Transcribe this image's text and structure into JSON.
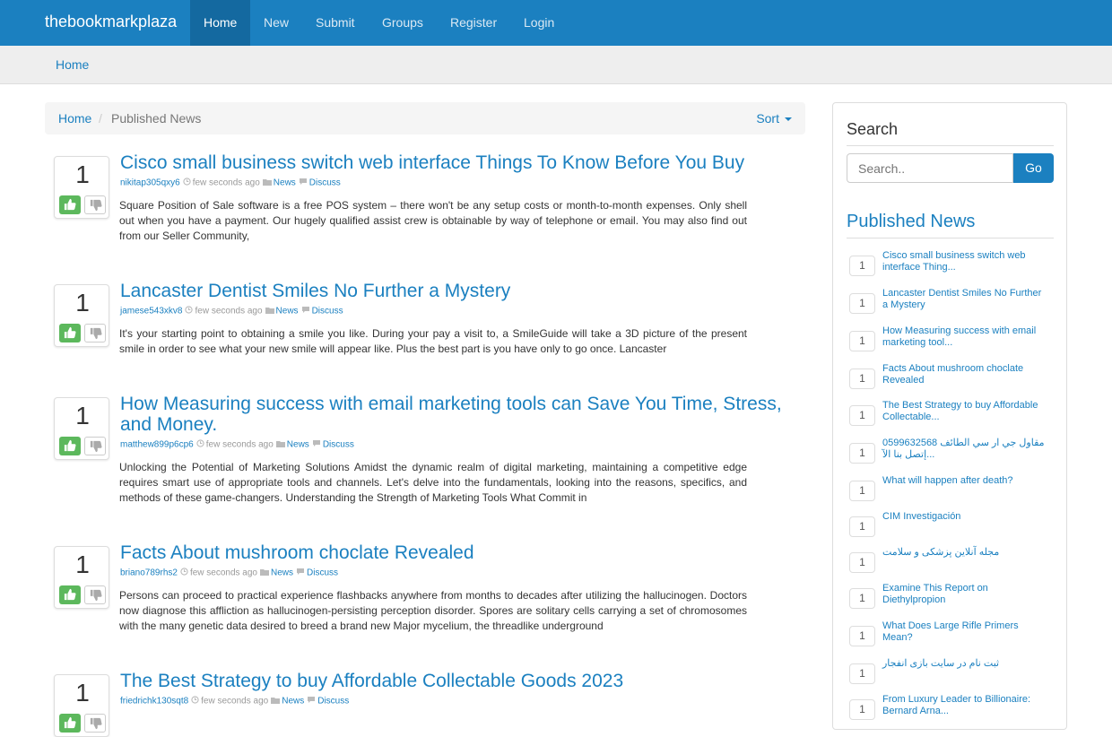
{
  "navbar": {
    "brand": "thebookmarkplaza",
    "items": [
      "Home",
      "New",
      "Submit",
      "Groups",
      "Register",
      "Login"
    ]
  },
  "subband": {
    "home": "Home"
  },
  "breadcrumb": {
    "home": "Home",
    "separator": "/",
    "current": "Published News",
    "sort_label": "Sort"
  },
  "colors": {
    "primary": "#1b80c0",
    "upvote": "#5cb85c"
  },
  "posts": [
    {
      "votes": "1",
      "title": "Cisco small business switch web interface Things To Know Before You Buy",
      "user": "nikitap305qxy6",
      "time": "few seconds ago",
      "category": "News",
      "discuss": "Discuss",
      "excerpt": "Square Position of Sale software is a free POS system – there won't be any setup costs or month-to-month expenses. Only shell out when you have a payment. Our hugely qualified assist crew is obtainable by way of telephone or email. You may also find out from our Seller Community,"
    },
    {
      "votes": "1",
      "title": "Lancaster Dentist Smiles No Further a Mystery",
      "user": "jamese543xkv8",
      "time": "few seconds ago",
      "category": "News",
      "discuss": "Discuss",
      "excerpt": "It's your starting point to obtaining a smile you like. During your pay a visit to, a SmileGuide will take a 3D picture of the present smile in order to see what your new smile will appear like. Plus the best part is you have only to go once. Lancaster"
    },
    {
      "votes": "1",
      "title": "How Measuring success with email marketing tools can Save You Time, Stress, and Money.",
      "user": "matthew899p6cp6",
      "time": "few seconds ago",
      "category": "News",
      "discuss": "Discuss",
      "excerpt": "Unlocking the Potential of Marketing Solutions Amidst the dynamic realm of digital marketing, maintaining a competitive edge requires smart use of appropriate tools and channels. Let's delve into the fundamentals, looking into the reasons, specifics, and methods of these game-changers. Understanding the Strength of Marketing Tools What Commit in"
    },
    {
      "votes": "1",
      "title": "Facts About mushroom choclate Revealed",
      "user": "briano789rhs2",
      "time": "few seconds ago",
      "category": "News",
      "discuss": "Discuss",
      "excerpt": "Persons can proceed to practical experience flashbacks anywhere from months to decades after utilizing the hallucinogen. Doctors now diagnose this affliction as hallucinogen-persisting perception disorder. Spores are solitary cells carrying a set of chromosomes with the many genetic data desired to breed a brand new Major mycelium, the threadlike underground"
    },
    {
      "votes": "1",
      "title": "The Best Strategy to buy Affordable Collectable Goods 2023",
      "user": "friedrichk130sqt8",
      "time": "few seconds ago",
      "category": "News",
      "discuss": "Discuss",
      "excerpt": ""
    }
  ],
  "sidebar": {
    "search_heading": "Search",
    "search_placeholder": "Search..",
    "go_label": "Go",
    "published_heading": "Published News",
    "items": [
      {
        "count": "1",
        "title": "Cisco small business switch web interface Thing..."
      },
      {
        "count": "1",
        "title": "Lancaster Dentist Smiles No Further a Mystery"
      },
      {
        "count": "1",
        "title": "How Measuring success with email marketing tool..."
      },
      {
        "count": "1",
        "title": "Facts About mushroom choclate Revealed"
      },
      {
        "count": "1",
        "title": "The Best Strategy to buy Affordable Collectable..."
      },
      {
        "count": "1",
        "title": "0599632568 مقاول جي ار سي الطائف إتصل بنا الآ..."
      },
      {
        "count": "1",
        "title": "What will happen after death?"
      },
      {
        "count": "1",
        "title": "CIM Investigación"
      },
      {
        "count": "1",
        "title": "مجله آنلاین پزشکی و سلامت"
      },
      {
        "count": "1",
        "title": "Examine This Report on Diethylpropion"
      },
      {
        "count": "1",
        "title": "What Does Large Rifle Primers Mean?"
      },
      {
        "count": "1",
        "title": "ثبت نام در سایت بازی انفجار"
      },
      {
        "count": "1",
        "title": "From Luxury Leader to Billionaire: Bernard Arna..."
      }
    ]
  }
}
